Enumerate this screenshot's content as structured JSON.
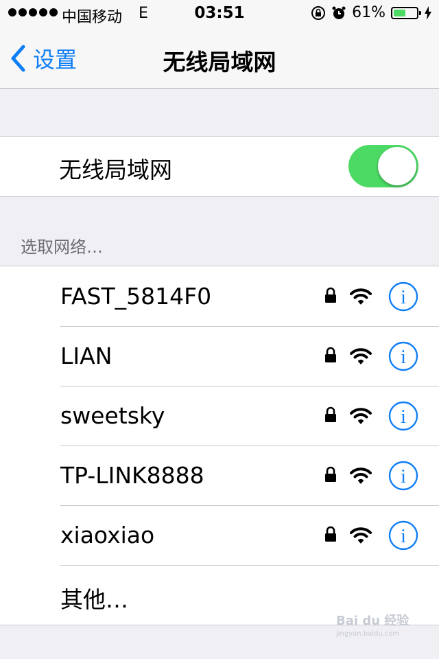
{
  "status_bar": {
    "carrier": "中国移动",
    "network": "E",
    "time": "03:51",
    "battery_percent": "61%",
    "battery_level": 0.61,
    "battery_color": "#4cd964"
  },
  "nav": {
    "back_label": "设置",
    "title": "无线局域网",
    "accent_color": "#0f7ef6"
  },
  "wifi_toggle": {
    "label": "无线局域网",
    "on": true
  },
  "section_header": "选取网络…",
  "networks": [
    {
      "name": "FAST_5814F0",
      "secured": true,
      "icon": "wifi-icon"
    },
    {
      "name": "LIAN",
      "secured": true,
      "icon": "wifi-icon"
    },
    {
      "name": "sweetsky",
      "secured": true,
      "icon": "wifi-icon"
    },
    {
      "name": "TP-LINK8888",
      "secured": true,
      "icon": "wifi-icon"
    },
    {
      "name": "xiaoxiao",
      "secured": true,
      "icon": "wifi-icon"
    }
  ],
  "other_label": "其他…",
  "watermark": {
    "text": "Bai du 经验",
    "sub": "jingyan.baidu.com"
  }
}
